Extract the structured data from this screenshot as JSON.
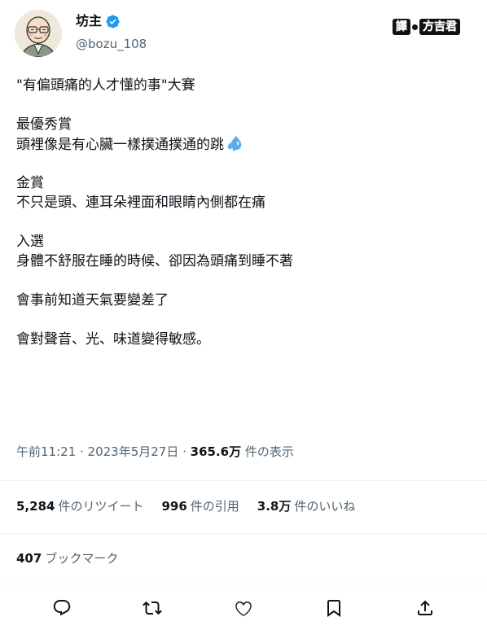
{
  "author": {
    "name": "坊主",
    "handle": "@bozu_108"
  },
  "translator_badge": {
    "prefix": "譯",
    "name": "方吉君"
  },
  "tweet": {
    "lines": [
      "\"有偏頭痛的人才懂的事\"大賽",
      "",
      "最優秀賞",
      "頭裡像是有心臟一樣撲通撲通的跳",
      "",
      "金賞",
      "不只是頭、連耳朵裡面和眼睛內側都在痛",
      "",
      "入選",
      "身體不舒服在睡的時候、卻因為頭痛到睡不著",
      "",
      "會事前知道天氣要變差了",
      "",
      "會對聲音、光、味道變得敏感。"
    ]
  },
  "meta": {
    "time": "午前11:21",
    "sep1": " · ",
    "date": "2023年5月27日",
    "sep2": " · ",
    "views_count": "365.6万",
    "views_label": " 件の表示"
  },
  "stats": {
    "retweets_count": "5,284",
    "retweets_label": "件のリツイート",
    "quotes_count": "996",
    "quotes_label": "件の引用",
    "likes_count": "3.8万",
    "likes_label": "件のいいね"
  },
  "bookmarks": {
    "count": "407",
    "label": "ブックマーク"
  },
  "icons": {
    "verified": "verified-badge-icon",
    "sweat": "sweat-droplets-icon",
    "reply": "reply-icon",
    "retweet": "retweet-icon",
    "like": "heart-icon",
    "bookmark": "bookmark-icon",
    "share": "share-icon"
  },
  "colors": {
    "verified": "#1d9bf0",
    "text_primary": "#0f1419",
    "text_secondary": "#536471",
    "divider": "#eff3f4"
  }
}
